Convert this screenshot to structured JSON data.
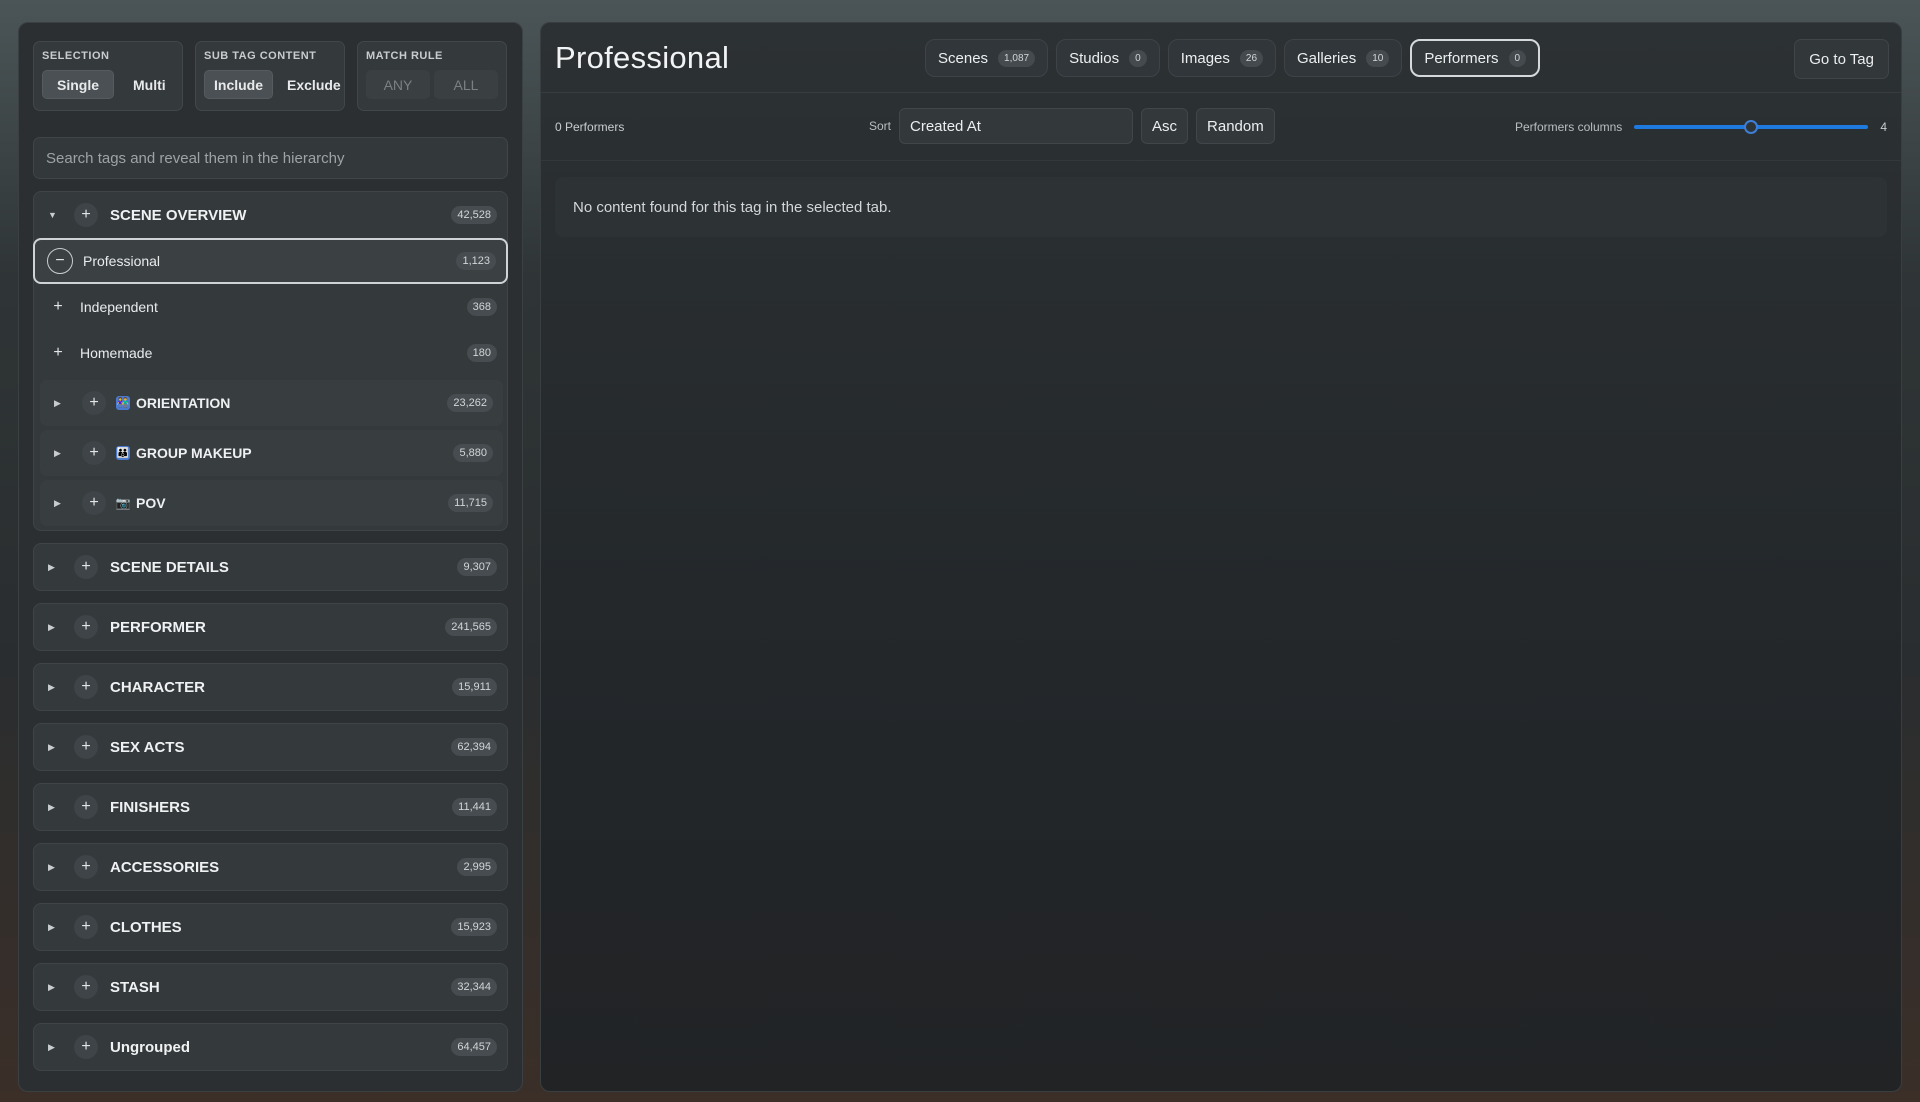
{
  "controls": {
    "selection": {
      "label": "SELECTION",
      "options": [
        "Single",
        "Multi"
      ],
      "active": "Single"
    },
    "sub_tag_content": {
      "label": "SUB TAG CONTENT",
      "options": [
        "Include",
        "Exclude"
      ],
      "active": "Include"
    },
    "match_rule": {
      "label": "MATCH RULE",
      "options": [
        "ANY",
        "ALL"
      ]
    }
  },
  "search": {
    "placeholder": "Search tags and reveal them in the hierarchy"
  },
  "tree": {
    "scene_overview": {
      "title": "SCENE OVERVIEW",
      "count": "42,528",
      "children": [
        {
          "title": "Professional",
          "count": "1,123"
        },
        {
          "title": "Independent",
          "count": "368"
        },
        {
          "title": "Homemade",
          "count": "180"
        }
      ],
      "subgroups": [
        {
          "title": "ORIENTATION",
          "count": "23,262"
        },
        {
          "title": "GROUP MAKEUP",
          "count": "5,880"
        },
        {
          "title": "POV",
          "count": "11,715"
        }
      ]
    },
    "groups": [
      {
        "title": "SCENE DETAILS",
        "count": "9,307"
      },
      {
        "title": "PERFORMER",
        "count": "241,565"
      },
      {
        "title": "CHARACTER",
        "count": "15,911"
      },
      {
        "title": "SEX ACTS",
        "count": "62,394"
      },
      {
        "title": "FINISHERS",
        "count": "11,441"
      },
      {
        "title": "ACCESSORIES",
        "count": "2,995"
      },
      {
        "title": "CLOTHES",
        "count": "15,923"
      },
      {
        "title": "STASH",
        "count": "32,344"
      },
      {
        "title": "Ungrouped",
        "count": "64,457"
      }
    ]
  },
  "main": {
    "title": "Professional",
    "tabs": [
      {
        "label": "Scenes",
        "count": "1,087"
      },
      {
        "label": "Studios",
        "count": "0"
      },
      {
        "label": "Images",
        "count": "26"
      },
      {
        "label": "Galleries",
        "count": "10"
      },
      {
        "label": "Performers",
        "count": "0"
      }
    ],
    "active_tab": "Performers",
    "goto_label": "Go to Tag",
    "result_count": "0 Performers",
    "sort_label": "Sort",
    "sort_value": "Created At",
    "asc_label": "Asc",
    "random_label": "Random",
    "columns_label": "Performers columns",
    "columns_value": "4",
    "columns_level": 0.5,
    "empty_message": "No content found for this tag in the selected tab."
  },
  "colors": {
    "accent": "#1f7ae0",
    "panel": "#2b2f31"
  },
  "icons": {
    "orientation": "people-icon",
    "group_makeup": "group-icon",
    "pov": "camera-icon"
  }
}
